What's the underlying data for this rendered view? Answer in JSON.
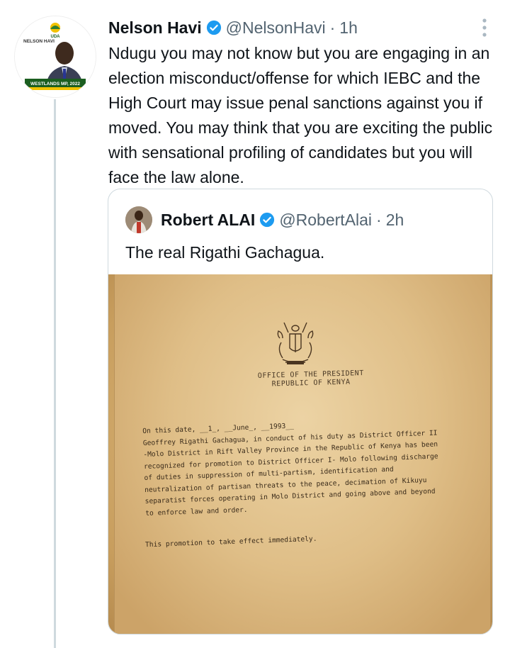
{
  "tweet": {
    "author_name": "Nelson Havi",
    "handle": "@NelsonHavi",
    "separator": "·",
    "time": "1h",
    "avatar_text": {
      "party": "UDA",
      "name_label": "NELSON HAVI",
      "banner": "WESTLANDS MP, 2022"
    },
    "text": "Ndugu you may not know but you are engaging in an election misconduct/offense for which IEBC and the High Court may issue penal sanctions against you if moved. You may think that you are exciting the public with sensational profiling of candidates but you will face the law alone."
  },
  "quoted_tweet": {
    "author_name": "Robert ALAI",
    "handle": "@RobertAlai",
    "separator": "·",
    "time": "2h",
    "text": "The real Rigathi Gachagua."
  },
  "document": {
    "office_line1": "OFFICE OF THE PRESIDENT",
    "office_line2": "REPUBLIC OF KENYA",
    "body_lines": [
      "On this date, __1_, __June_, __1993__",
      "Geoffrey Rigathi Gachagua, in conduct of his duty as District Officer II",
      "-Molo District in Rift Valley Province in the Republic of Kenya has been",
      "recognized for promotion to District Officer I- Molo following discharge",
      "of duties in suppression of multi-partism, identification and",
      "neutralization of partisan threats to the peace, decimation of Kikuyu",
      "separatist forces operating in Molo District and going above and beyond",
      "to enforce law and order."
    ],
    "promotion_line": "This promotion to take effect immediately."
  },
  "icons": {
    "verified": "verified-badge-icon",
    "more": "more-vertical-icon"
  },
  "colors": {
    "verified": "#1d9bf0",
    "muted_text": "#536471",
    "thread_line": "#cfd9de",
    "border": "#cfd9de"
  }
}
